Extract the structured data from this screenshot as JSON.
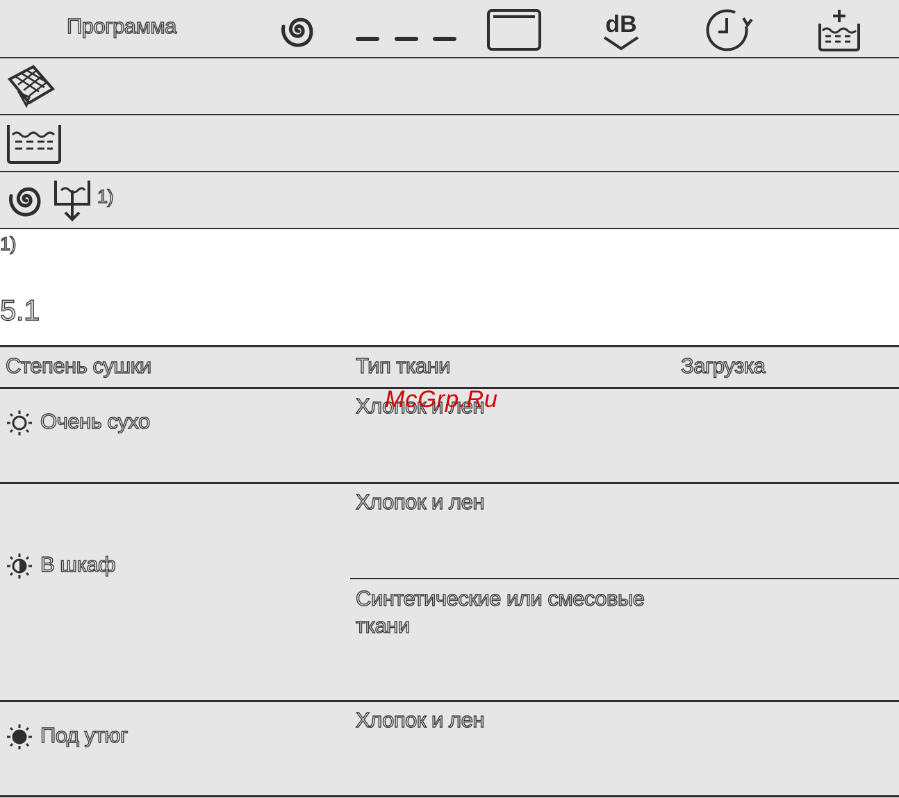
{
  "table1": {
    "header": {
      "program_label": "Программа",
      "column_icons": [
        "spin-spiral-icon",
        "dashed-lines-icon",
        "drum-icon",
        "low-noise-db-icon",
        "timer-icon",
        "extra-water-icon"
      ]
    },
    "rows": [
      {
        "icon": "anti-crease-fabric-icon"
      },
      {
        "icon": "water-tub-icon"
      },
      {
        "icons": [
          "spin-spiral-icon",
          "drain-icon"
        ],
        "footnote_ref": "1)"
      }
    ]
  },
  "footnote": {
    "marker": "1)"
  },
  "section": {
    "number": "5.1"
  },
  "table2": {
    "headers": [
      "Степень сушки",
      "Тип ткани",
      "Загрузка"
    ],
    "rows": [
      {
        "level_icon": "sun-empty-icon",
        "level": "Очень сухо",
        "fabrics": [
          "Хлопок и лен"
        ]
      },
      {
        "level_icon": "sun-half-icon",
        "level": "В шкаф",
        "fabrics": [
          "Хлопок и лен",
          "Синтетические или смесовые ткани"
        ]
      },
      {
        "level_icon": "sun-full-icon",
        "level": "Под утюг",
        "fabrics": [
          "Хлопок и лен"
        ]
      }
    ]
  },
  "watermark": "McGrp.Ru",
  "colors": {
    "background": "#e6e6e6",
    "rule": "#2e2e2e",
    "watermark": "#d30000"
  }
}
